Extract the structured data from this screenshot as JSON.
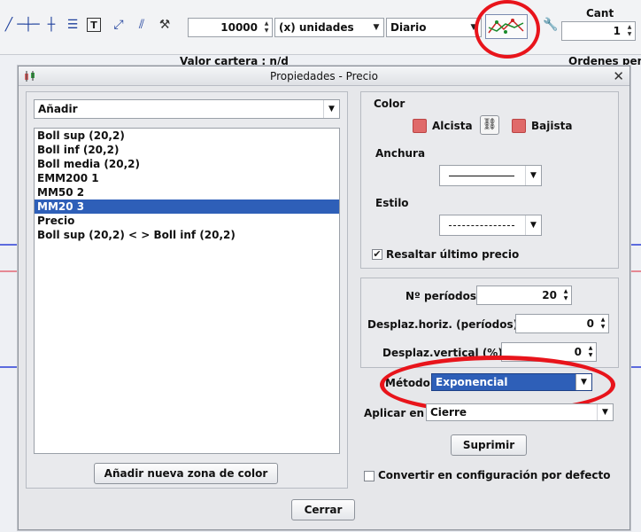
{
  "toolbar": {
    "icons": [
      "line-tool-icon",
      "horizontal-line-icon",
      "vertical-line-icon",
      "fibonacci-icon",
      "text-tool-icon",
      "trend-line-icon",
      "parallel-lines-icon",
      "tools-icon"
    ],
    "quantity_value": "10000",
    "units_combo": "(x) unidades",
    "period_combo": "Diario",
    "cant_label": "Cant",
    "cant_value": "1"
  },
  "status": {
    "portfolio_value": "Valor cartera : n/d",
    "orders": "Ordenes pen"
  },
  "dialog": {
    "title": "Propiedades - Precio",
    "add_combo": "Añadir",
    "series": [
      "Boll sup (20,2)",
      "Boll inf (20,2)",
      "Boll media (20,2)",
      "EMM200 1",
      "MM50 2",
      "MM20 3",
      "Precio",
      "Boll sup (20,2) < > Boll inf (20,2)"
    ],
    "selected_series_index": 5,
    "add_color_zone_button": "Añadir nueva zona de color",
    "close_button": "Cerrar",
    "color_label": "Color",
    "bullish_label": "Alcista",
    "bearish_label": "Bajista",
    "width_label": "Anchura",
    "style_label": "Estilo",
    "highlight_last_price": "Resaltar último precio",
    "highlight_checked": true,
    "periods_label": "Nº períodos",
    "periods_value": "20",
    "h_shift_label": "Desplaz.horiz. (períodos)",
    "h_shift_value": "0",
    "v_shift_label": "Desplaz.vertical (%)",
    "v_shift_value": "0",
    "method_label": "Método",
    "method_value": "Exponencial",
    "apply_on_label": "Aplicar en",
    "apply_on_value": "Cierre",
    "delete_button": "Suprimir",
    "default_config_label": "Convertir en configuración por defecto",
    "default_config_checked": false,
    "colors": {
      "bullish": "#e06a6a",
      "bearish": "#e06a6a",
      "selection": "#2e5fb8",
      "annotation": "#e8141b"
    }
  }
}
